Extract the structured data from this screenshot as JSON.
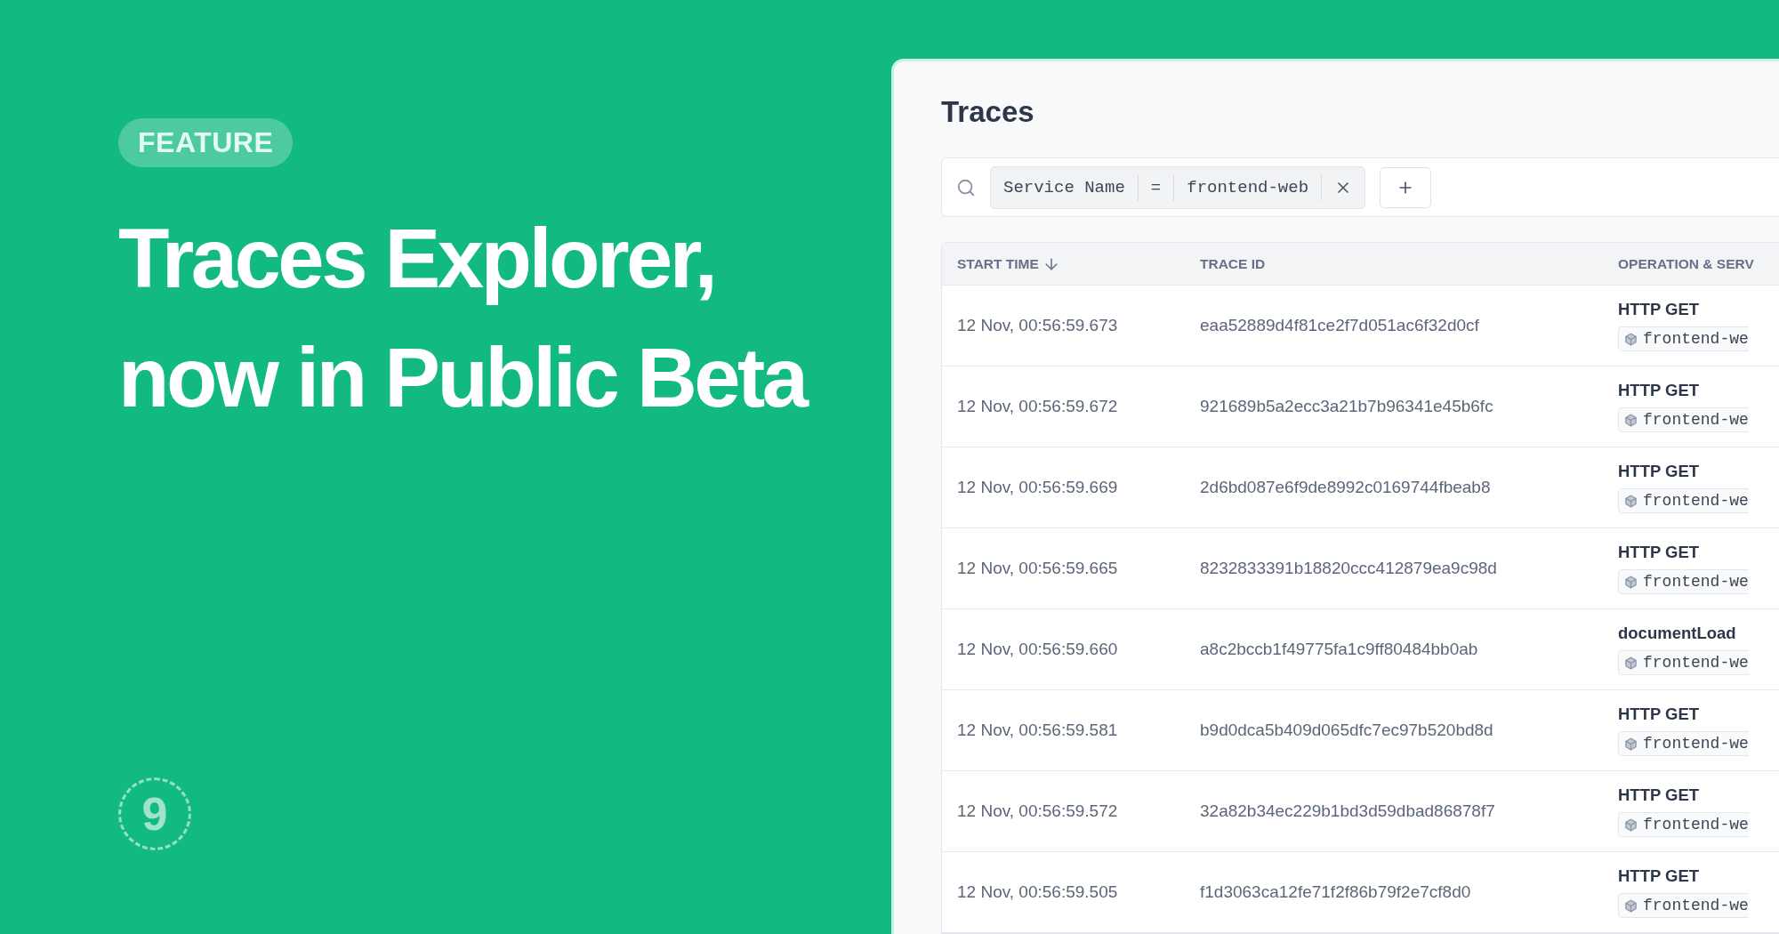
{
  "promo": {
    "badge": "FEATURE",
    "headline": "Traces Explorer, now in Public Beta",
    "logo_mark": "9"
  },
  "panel": {
    "title": "Traces",
    "filter": {
      "key": "Service Name",
      "operator": "=",
      "value": "frontend-web"
    },
    "table": {
      "columns": [
        {
          "label": "START TIME",
          "sorted": true
        },
        {
          "label": "TRACE ID",
          "sorted": false
        },
        {
          "label": "OPERATION & SERV",
          "sorted": false
        }
      ],
      "rows": [
        {
          "start_time": "12 Nov, 00:56:59.673",
          "trace_id": "eaa52889d4f81ce2f7d051ac6f32d0cf",
          "operation": "HTTP GET",
          "service": "frontend-we"
        },
        {
          "start_time": "12 Nov, 00:56:59.672",
          "trace_id": "921689b5a2ecc3a21b7b96341e45b6fc",
          "operation": "HTTP GET",
          "service": "frontend-we"
        },
        {
          "start_time": "12 Nov, 00:56:59.669",
          "trace_id": "2d6bd087e6f9de8992c0169744fbeab8",
          "operation": "HTTP GET",
          "service": "frontend-we"
        },
        {
          "start_time": "12 Nov, 00:56:59.665",
          "trace_id": "8232833391b18820ccc412879ea9c98d",
          "operation": "HTTP GET",
          "service": "frontend-we"
        },
        {
          "start_time": "12 Nov, 00:56:59.660",
          "trace_id": "a8c2bccb1f49775fa1c9ff80484bb0ab",
          "operation": "documentLoad",
          "service": "frontend-we"
        },
        {
          "start_time": "12 Nov, 00:56:59.581",
          "trace_id": "b9d0dca5b409d065dfc7ec97b520bd8d",
          "operation": "HTTP GET",
          "service": "frontend-we"
        },
        {
          "start_time": "12 Nov, 00:56:59.572",
          "trace_id": "32a82b34ec229b1bd3d59dbad86878f7",
          "operation": "HTTP GET",
          "service": "frontend-we"
        },
        {
          "start_time": "12 Nov, 00:56:59.505",
          "trace_id": "f1d3063ca12fe71f2f86b79f2e7cf8d0",
          "operation": "HTTP GET",
          "service": "frontend-we"
        }
      ]
    }
  }
}
